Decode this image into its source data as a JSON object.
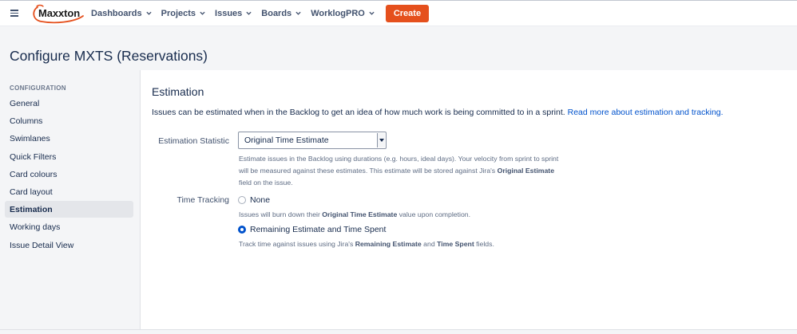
{
  "nav": {
    "logo_text": "Maxxton",
    "items": [
      {
        "label": "Dashboards"
      },
      {
        "label": "Projects"
      },
      {
        "label": "Issues"
      },
      {
        "label": "Boards"
      },
      {
        "label": "WorklogPRO"
      }
    ],
    "create_label": "Create"
  },
  "page": {
    "title": "Configure MXTS (Reservations)"
  },
  "sidebar": {
    "heading": "CONFIGURATION",
    "items": [
      {
        "label": "General"
      },
      {
        "label": "Columns"
      },
      {
        "label": "Swimlanes"
      },
      {
        "label": "Quick Filters"
      },
      {
        "label": "Card colours"
      },
      {
        "label": "Card layout"
      },
      {
        "label": "Estimation"
      },
      {
        "label": "Working days"
      },
      {
        "label": "Issue Detail View"
      }
    ],
    "active": "Estimation"
  },
  "main": {
    "section_title": "Estimation",
    "intro_text": "Issues can be estimated when in the Backlog to get an idea of how much work is being committed to in a sprint. ",
    "intro_link": "Read more about estimation and tracking.",
    "estimation_statistic": {
      "label": "Estimation Statistic",
      "value": "Original Time Estimate",
      "help": {
        "line1": "Estimate issues in the Backlog using durations (e.g. hours, ideal days). Your velocity from sprint to sprint",
        "line2_pre": "will be measured against these estimates. This estimate will be stored against Jira's ",
        "line2_bold": "Original Estimate",
        "line3": "field on the issue."
      }
    },
    "time_tracking": {
      "label": "Time Tracking",
      "options": [
        {
          "label": "None",
          "checked": false,
          "help_pre": "Issues will burn down their ",
          "help_bold": "Original Time Estimate",
          "help_post": " value upon completion."
        },
        {
          "label": "Remaining Estimate and Time Spent",
          "checked": true,
          "help_pre": "Track time against issues using Jira's ",
          "help_bold": "Remaining Estimate",
          "help_mid": " and ",
          "help_bold2": "Time Spent",
          "help_post": " fields."
        }
      ]
    }
  },
  "colors": {
    "create_button": "#e5501d",
    "link": "#0052cc",
    "radio_checked": "#0052cc"
  }
}
